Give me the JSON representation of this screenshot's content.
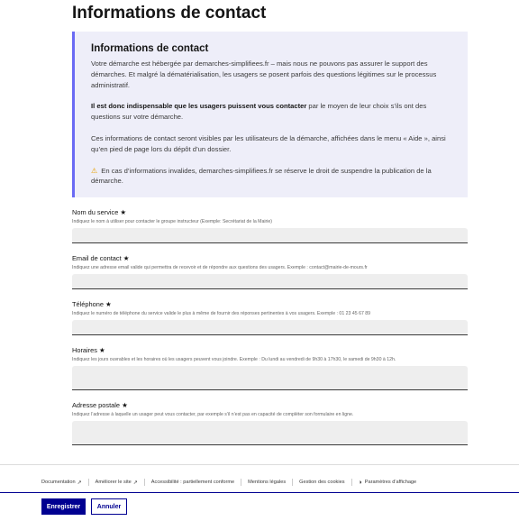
{
  "page": {
    "title": "Informations de contact"
  },
  "callout": {
    "title": "Informations de contact",
    "p1": "Votre démarche est hébergée par demarches-simplifiees.fr – mais nous ne pouvons pas assurer le support des démarches. Et malgré la dématérialisation, les usagers se posent parfois des questions légitimes sur le processus administratif.",
    "p2_bold": "Il est donc indispensable que les usagers puissent vous contacter",
    "p2_rest": " par le moyen de leur choix s’ils ont des questions sur votre démarche.",
    "p3": "Ces informations de contact seront visibles par les utilisateurs de la démarche, affichées dans le menu « Aide », ainsi qu’en pied de page lors du dépôt d’un dossier.",
    "p4": "En cas d’informations invalides, demarches-simplifiees.fr se réserve le droit de suspendre la publication de la démarche.",
    "warning_icon": "⚠"
  },
  "form": {
    "required_mark": "★",
    "service": {
      "label": "Nom du service",
      "hint": "Indiquez le nom à utiliser pour contacter le groupe instructeur (Exemple: Secrétariat de la Mairie)",
      "value": ""
    },
    "email": {
      "label": "Email de contact",
      "hint": "Indiquez une adresse email valide qui permettra de recevoir et de répondre aux questions des usagers. Exemple : contact@mairie-de-mours.fr",
      "value": ""
    },
    "phone": {
      "label": "Téléphone",
      "hint": "Indiquez le numéro de téléphone du service valide le plus à même de fournir des réponses pertinentes à vos usagers. Exemple : 01 23 45 67 89",
      "value": ""
    },
    "hours": {
      "label": "Horaires",
      "hint": "Indiquez les jours ouvrables et les horaires où les usagers peuvent vous joindre. Exemple : Du lundi au vendredi de 9h30 à 17h30, le samedi de 9h30 à 12h.",
      "value": ""
    },
    "address": {
      "label": "Adresse postale",
      "hint": "Indiquez l’adresse à laquelle un usager peut vous contacter, par exemple s’il n’est pas en capacité de compléter son formulaire en ligne.",
      "value": ""
    }
  },
  "footer": {
    "documentation": "Documentation",
    "ameliorer": "Améliorer le site",
    "accessibilite": "Accessibilité : partiellement conforme",
    "mentions": "Mentions légales",
    "cookies": "Gestion des cookies",
    "parametres": "Paramètres d’affichage",
    "external_icon": "↗",
    "settings_icon": "◑"
  },
  "actions": {
    "save": "Enregistrer",
    "cancel": "Annuler"
  }
}
